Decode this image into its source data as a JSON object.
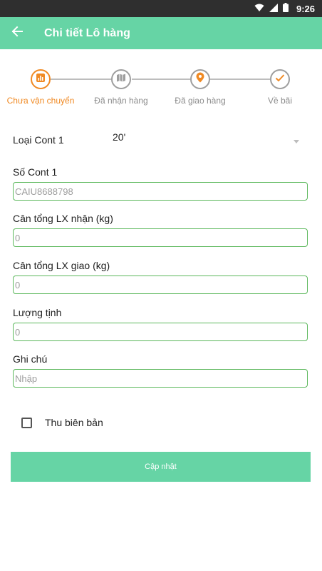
{
  "status_bar": {
    "time": "9:26",
    "icons": [
      "wifi-icon",
      "signal-icon",
      "battery-icon"
    ]
  },
  "app_bar": {
    "title": "Chi tiết Lô hàng",
    "back_icon": "arrow-back-icon"
  },
  "stepper": {
    "steps": [
      {
        "label": "Chưa vận chuyển",
        "icon": "chart-icon",
        "active": true
      },
      {
        "label": "Đã nhận hàng",
        "icon": "map-icon",
        "active": false
      },
      {
        "label": "Đã giao hàng",
        "icon": "location-pin-icon",
        "active": false
      },
      {
        "label": "Về bãi",
        "icon": "check-icon",
        "active": false
      }
    ]
  },
  "form": {
    "container_type": {
      "label": "Loại Cont 1",
      "value": "20'"
    },
    "container_number": {
      "label": "Số Cont 1",
      "value": "CAIU8688798"
    },
    "received_weight": {
      "label": "Cân tổng LX nhận (kg)",
      "value": "0"
    },
    "delivered_weight": {
      "label": "Cân tổng LX giao (kg)",
      "value": "0"
    },
    "net_weight": {
      "label": "Lượng tịnh",
      "value": "0"
    },
    "note": {
      "label": "Ghi chú",
      "placeholder": "Nhập"
    },
    "collect_report": {
      "label": "Thu biên bản",
      "checked": false
    }
  },
  "actions": {
    "update_label": "Cập nhật"
  },
  "colors": {
    "primary": "#66d4a5",
    "active_step": "#f08a24",
    "input_border": "#5cb85c",
    "inactive": "#9e9e9e"
  }
}
